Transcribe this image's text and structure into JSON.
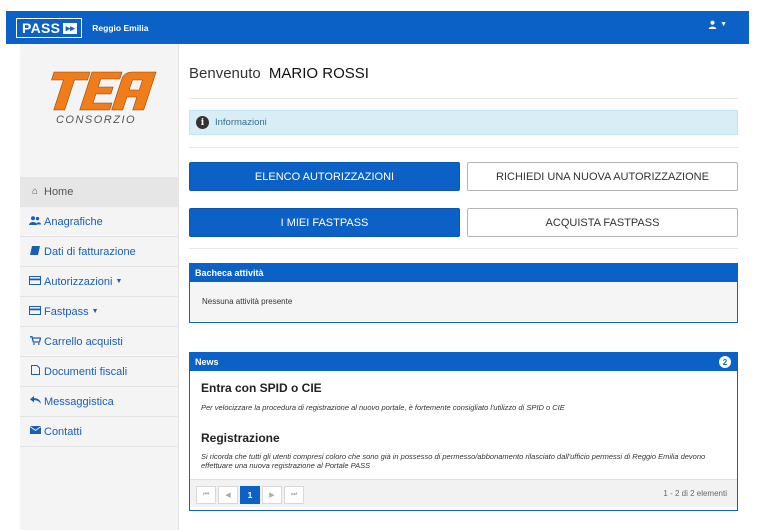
{
  "topbar": {
    "logo_text": "PASS",
    "city": "Reggio Emilia",
    "user_icon": "user-icon"
  },
  "sidebar": {
    "logo": {
      "main": "TEA",
      "sub": "CONSORZIO"
    },
    "items": [
      {
        "label": "Home",
        "icon": "home-icon",
        "glyph": "⌂",
        "active": true
      },
      {
        "label": "Anagrafiche",
        "icon": "users-icon",
        "glyph": "👥"
      },
      {
        "label": "Dati di fatturazione",
        "icon": "book-icon",
        "glyph": "▰"
      },
      {
        "label": "Autorizzazioni",
        "icon": "card-icon",
        "glyph": "▭",
        "caret": true
      },
      {
        "label": "Fastpass",
        "icon": "card-icon",
        "glyph": "▭",
        "caret": true
      },
      {
        "label": "Carrello acquisti",
        "icon": "cart-icon",
        "glyph": "🛒"
      },
      {
        "label": "Documenti fiscali",
        "icon": "file-icon",
        "glyph": "▯"
      },
      {
        "label": "Messaggistica",
        "icon": "reply-icon",
        "glyph": "↶"
      },
      {
        "label": "Contatti",
        "icon": "envelope-icon",
        "glyph": "✉"
      }
    ]
  },
  "main": {
    "welcome_label": "Benvenuto",
    "user_name": "MARIO ROSSI",
    "info_label": "Informazioni",
    "buttons": {
      "elenco": "ELENCO AUTORIZZAZIONI",
      "richiedi": "RICHIEDI UNA NUOVA AUTORIZZAZIONE",
      "miei_fastpass": "I MIEI FASTPASS",
      "acquista": "ACQUISTA FASTPASS"
    },
    "bacheca": {
      "title": "Bacheca attività",
      "empty": "Nessuna attività presente"
    },
    "news": {
      "title": "News",
      "count": "2",
      "items": [
        {
          "title": "Entra con SPID o CIE",
          "text": "Per velocizzare la procedura di registrazione al nuovo portale, è fortemente consigliato l'utilizzo di SPID o CIE"
        },
        {
          "title": "Registrazione",
          "text": "Si ricorda che tutti gli utenti compresi coloro che sono già in possesso di permesso/abbonamento rilasciato dall'ufficio permessi di Reggio Emilia devono effettuare una nuova registrazione al Portale PASS"
        }
      ],
      "pager": {
        "first": "⏮",
        "prev": "◀",
        "current": "1",
        "next": "▶",
        "last": "⏭",
        "info": "1 - 2 di 2 elementi"
      }
    }
  },
  "colors": {
    "primary": "#0b61c6",
    "info_bg": "#d9edf7",
    "logo_orange": "#f07d1a"
  }
}
